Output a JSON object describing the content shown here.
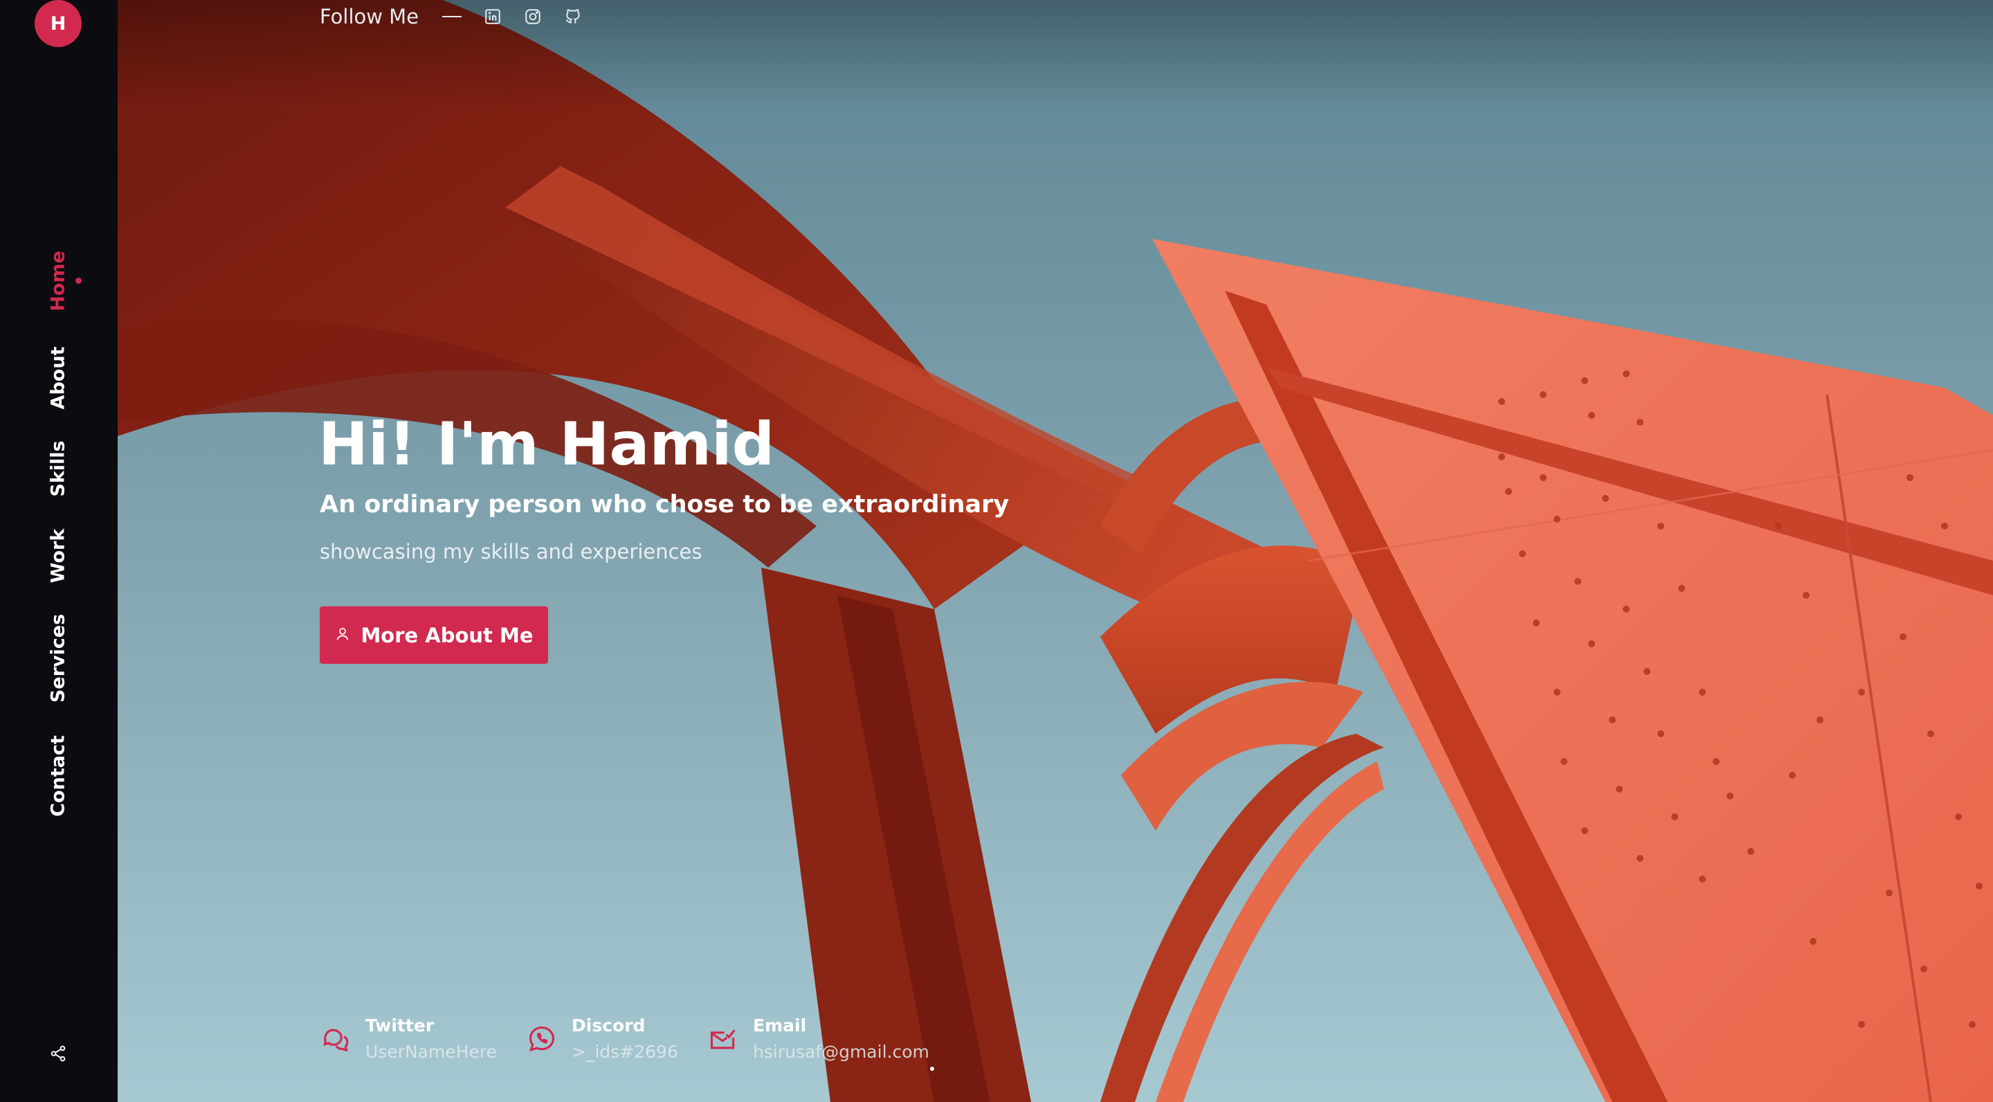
{
  "brand": {
    "logo_letter": "H"
  },
  "nav": {
    "items": [
      {
        "label": "Home",
        "active": true
      },
      {
        "label": "About",
        "active": false
      },
      {
        "label": "Skills",
        "active": false
      },
      {
        "label": "Work",
        "active": false
      },
      {
        "label": "Services",
        "active": false
      },
      {
        "label": "Contact",
        "active": false
      }
    ],
    "share_icon": "share-icon"
  },
  "follow": {
    "label": "Follow Me",
    "icons": [
      "linkedin-icon",
      "instagram-icon",
      "github-icon"
    ]
  },
  "hero": {
    "title": "Hi! I'm Hamid",
    "subtitle": "An ordinary person who chose to be extraordinary",
    "tagline": "showcasing my skills and experiences",
    "cta_label": "More About Me",
    "cta_icon": "user-icon"
  },
  "contacts": [
    {
      "title": "Twitter",
      "value": "UserNameHere",
      "icon": "chat-bubbles-icon"
    },
    {
      "title": "Discord",
      "value": ">_ids#2696",
      "icon": "phone-chat-icon"
    },
    {
      "title": "Email",
      "value": "hsirusaf@gmail.com",
      "icon": "mail-icon"
    }
  ],
  "colors": {
    "accent": "#d2294f",
    "sidebar": "#0b0b10",
    "sky_top": "#5d8594",
    "sky_bottom": "#a6c8d1",
    "sculpture_dark": "#7a1c10",
    "sculpture_light": "#ef7459"
  }
}
